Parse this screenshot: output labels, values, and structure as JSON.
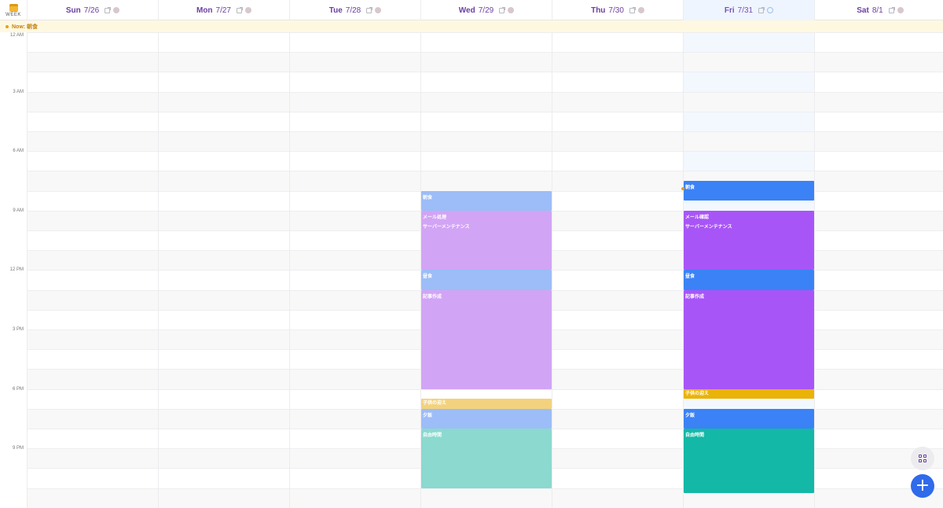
{
  "view": {
    "label": "WEEK",
    "icon": "calendar-icon"
  },
  "now_banner": {
    "text": "Now: 朝食"
  },
  "days": [
    {
      "name": "Sun",
      "date": "7/26",
      "today": false
    },
    {
      "name": "Mon",
      "date": "7/27",
      "today": false
    },
    {
      "name": "Tue",
      "date": "7/28",
      "today": false
    },
    {
      "name": "Wed",
      "date": "7/29",
      "today": false
    },
    {
      "name": "Thu",
      "date": "7/30",
      "today": false
    },
    {
      "name": "Fri",
      "date": "7/31",
      "today": true
    },
    {
      "name": "Sat",
      "date": "8/1",
      "today": false
    }
  ],
  "time_labels": [
    {
      "hour": 0,
      "label": "12 AM"
    },
    {
      "hour": 3,
      "label": "3 AM"
    },
    {
      "hour": 6,
      "label": "6 AM"
    },
    {
      "hour": 9,
      "label": "9 AM"
    },
    {
      "hour": 12,
      "label": "12 PM"
    },
    {
      "hour": 15,
      "label": "3 PM"
    },
    {
      "hour": 18,
      "label": "6 PM"
    },
    {
      "hour": 21,
      "label": "9 PM"
    }
  ],
  "events": [
    {
      "day": 3,
      "start": 8.0,
      "end": 9.0,
      "lines": [
        "朝食"
      ],
      "color": "#9cbdf7"
    },
    {
      "day": 3,
      "start": 9.0,
      "end": 12.0,
      "lines": [
        "メール処理",
        "サーバーメンテナンス"
      ],
      "color": "#d2a4f5"
    },
    {
      "day": 3,
      "start": 12.0,
      "end": 13.0,
      "lines": [
        "昼食"
      ],
      "color": "#9cbdf7"
    },
    {
      "day": 3,
      "start": 13.0,
      "end": 18.0,
      "lines": [
        "記事作成"
      ],
      "color": "#d2a4f5"
    },
    {
      "day": 3,
      "start": 18.5,
      "end": 19.0,
      "lines": [
        "子供の迎え"
      ],
      "color": "#f3d27e"
    },
    {
      "day": 3,
      "start": 19.0,
      "end": 20.0,
      "lines": [
        "夕飯"
      ],
      "color": "#9cbdf7"
    },
    {
      "day": 3,
      "start": 20.0,
      "end": 23.0,
      "lines": [
        "自由時間"
      ],
      "color": "#8bd9cf"
    },
    {
      "day": 5,
      "start": 7.5,
      "end": 8.5,
      "lines": [
        "朝食"
      ],
      "color": "#3b82f6"
    },
    {
      "day": 5,
      "start": 9.0,
      "end": 12.0,
      "lines": [
        "メール確認",
        "サーバーメンテナンス"
      ],
      "color": "#a855f7"
    },
    {
      "day": 5,
      "start": 12.0,
      "end": 13.0,
      "lines": [
        "昼食"
      ],
      "color": "#3b82f6"
    },
    {
      "day": 5,
      "start": 13.0,
      "end": 18.0,
      "lines": [
        "記事作成"
      ],
      "color": "#a855f7"
    },
    {
      "day": 5,
      "start": 18.0,
      "end": 18.5,
      "lines": [
        "子供の迎え"
      ],
      "color": "#eab308"
    },
    {
      "day": 5,
      "start": 19.0,
      "end": 20.0,
      "lines": [
        "夕飯"
      ],
      "color": "#3b82f6"
    },
    {
      "day": 5,
      "start": 20.0,
      "end": 23.25,
      "lines": [
        "自由時間"
      ],
      "color": "#14b8a6"
    }
  ],
  "now_hour": 7.9,
  "buttons": {
    "grid_icon": "grid-icon",
    "add_label": "+"
  }
}
